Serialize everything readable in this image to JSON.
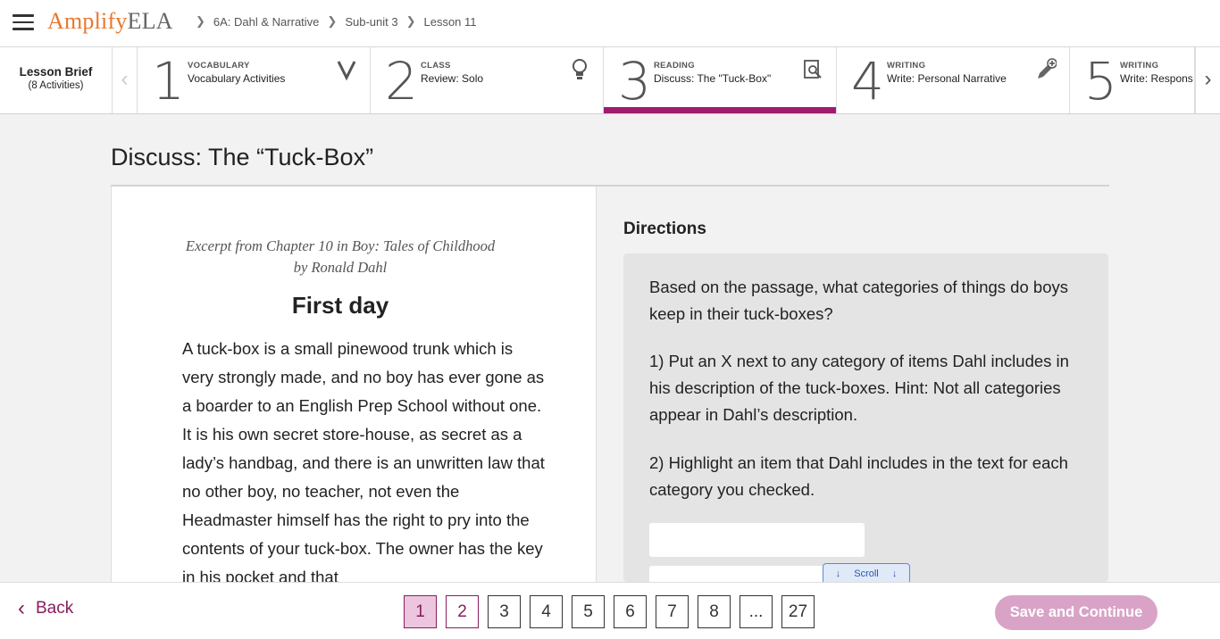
{
  "header": {
    "logo_main": "Amplify",
    "logo_sub": "ELA",
    "breadcrumbs": [
      "6A: Dahl & Narrative",
      "Sub-unit 3",
      "Lesson 11"
    ]
  },
  "activity_bar": {
    "brief_title": "Lesson Brief",
    "brief_count": "(8 Activities)",
    "activities": [
      {
        "number": "1",
        "kind": "VOCABULARY",
        "name": "Vocabulary Activities",
        "icon": "vocabulary-v-icon"
      },
      {
        "number": "2",
        "kind": "CLASS",
        "name": "Review: Solo",
        "icon": "lightbulb-icon"
      },
      {
        "number": "3",
        "kind": "READING",
        "name": "Discuss: The \"Tuck-Box\"",
        "icon": "document-search-icon",
        "active": true
      },
      {
        "number": "4",
        "kind": "WRITING",
        "name": "Write: Personal Narrative",
        "icon": "pencil-plus-icon"
      },
      {
        "number": "5",
        "kind": "WRITING",
        "name": "Write: Respons",
        "icon": ""
      }
    ],
    "accent_color": "#a01c6e"
  },
  "main": {
    "title": "Discuss: The “Tuck-Box”",
    "excerpt_line1": "Excerpt from Chapter 10 in Boy: Tales of Childhood",
    "excerpt_line2": "by Ronald Dahl",
    "passage_title": "First day",
    "passage_text": "A tuck-box is a small pinewood trunk which is very strongly made, and no boy has ever gone as a boarder to an English Prep School without one. It is his own secret store-house, as secret as a lady’s handbag, and there is an unwritten law that no other boy, no teacher, not even the Headmaster himself has the right to pry into the contents of your tuck-box. The owner has the key in his pocket and that",
    "directions_heading": "Directions",
    "directions": [
      "Based on the passage, what categories of things do boys keep in their tuck-boxes?",
      "1) Put an X next to any category of items Dahl includes in his description of the tuck-boxes. Hint: Not all categories appear in Dahl’s description.",
      "2) Highlight an item that Dahl includes in the text for each category you checked."
    ],
    "scroll_label": "Scroll"
  },
  "footer": {
    "back_label": "Back",
    "pages": [
      "1",
      "2",
      "3",
      "4",
      "5",
      "6",
      "7",
      "8",
      "...",
      "27"
    ],
    "current_page": "1",
    "save_label": "Save and Continue"
  }
}
